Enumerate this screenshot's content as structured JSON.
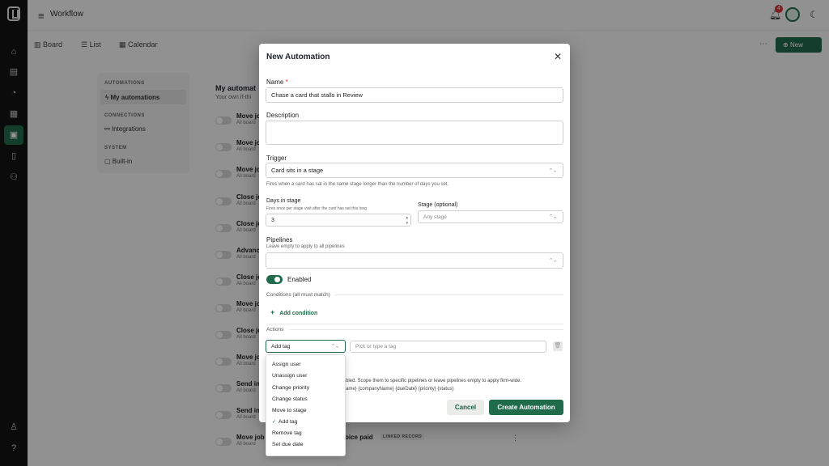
{
  "app": {
    "title": "Workflow",
    "notifications_count": "4"
  },
  "views": {
    "tabs": [
      {
        "icon": "board-icon",
        "label": "Board"
      },
      {
        "icon": "list-icon",
        "label": "List"
      },
      {
        "icon": "calendar-icon",
        "label": "Calendar"
      }
    ],
    "new_label": "New"
  },
  "sidebar": {
    "sections": [
      {
        "title": "AUTOMATIONS",
        "items": [
          {
            "label": "My automations",
            "active": true
          }
        ]
      },
      {
        "title": "CONNECTIONS",
        "items": [
          {
            "label": "Integrations"
          }
        ]
      },
      {
        "title": "SYSTEM",
        "items": [
          {
            "label": "Built-in"
          }
        ]
      }
    ]
  },
  "list": {
    "heading": "My automat",
    "subheading": "Your own if-thi",
    "rows": [
      {
        "name": "Move jo",
        "sub": "All board"
      },
      {
        "name": "Move jo",
        "sub": "All board"
      },
      {
        "name": "Move jo",
        "sub": "All board"
      },
      {
        "name": "Close jo",
        "sub": "All board"
      },
      {
        "name": "Close jo",
        "sub": "All board"
      },
      {
        "name": "Advanc",
        "sub": "All board"
      },
      {
        "name": "Close jo",
        "sub": "All board"
      },
      {
        "name": "Move jo",
        "sub": "All board"
      },
      {
        "name": "Close jo",
        "sub": "All board"
      },
      {
        "name": "Move jo",
        "sub": "All board"
      },
      {
        "name": "Send in",
        "sub": "All board"
      },
      {
        "name": "Send in",
        "sub": "All board"
      },
      {
        "name": "Move job",
        "sub": "All board",
        "tail": "oice paid",
        "tag": "LINKED RECORD"
      }
    ]
  },
  "modal": {
    "title": "New Automation",
    "name_label": "Name",
    "name_value": "Chase a card that stalls in Review",
    "description_label": "Description",
    "description_value": "",
    "trigger_label": "Trigger",
    "trigger_value": "Card sits in a stage",
    "trigger_hint": "Fires when a card has sat in the same stage longer than the number of days you set.",
    "days_label": "Days in stage",
    "days_hint": "Fires once per stage visit after the card has sat this long",
    "days_value": "3",
    "stage_label": "Stage (optional)",
    "stage_placeholder": "Any stage",
    "pipelines_label": "Pipelines",
    "pipelines_hint": "Leave empty to apply to all pipelines",
    "enabled_label": "Enabled",
    "enabled": true,
    "conditions_label": "Conditions (all must match)",
    "add_condition_label": "Add condition",
    "actions_label": "Actions",
    "action_type_value": "Add tag",
    "tag_placeholder": "Pick or type a tag",
    "footer_line1": "bled. Scope them to specific pipelines or leave pipelines empty to apply firm-wide.",
    "footer_line2": "ame} {companyName} {dueDate} {priority} {status}",
    "cancel_label": "Cancel",
    "create_label": "Create Automation"
  },
  "action_options": [
    {
      "label": "Assign user"
    },
    {
      "label": "Unassign user"
    },
    {
      "label": "Change priority"
    },
    {
      "label": "Change status"
    },
    {
      "label": "Move to stage"
    },
    {
      "label": "Add tag",
      "selected": true
    },
    {
      "label": "Remove tag"
    },
    {
      "label": "Set due date"
    }
  ],
  "colors": {
    "accent": "#1f6b4a",
    "rail": "#141414",
    "required": "#dd3333"
  }
}
